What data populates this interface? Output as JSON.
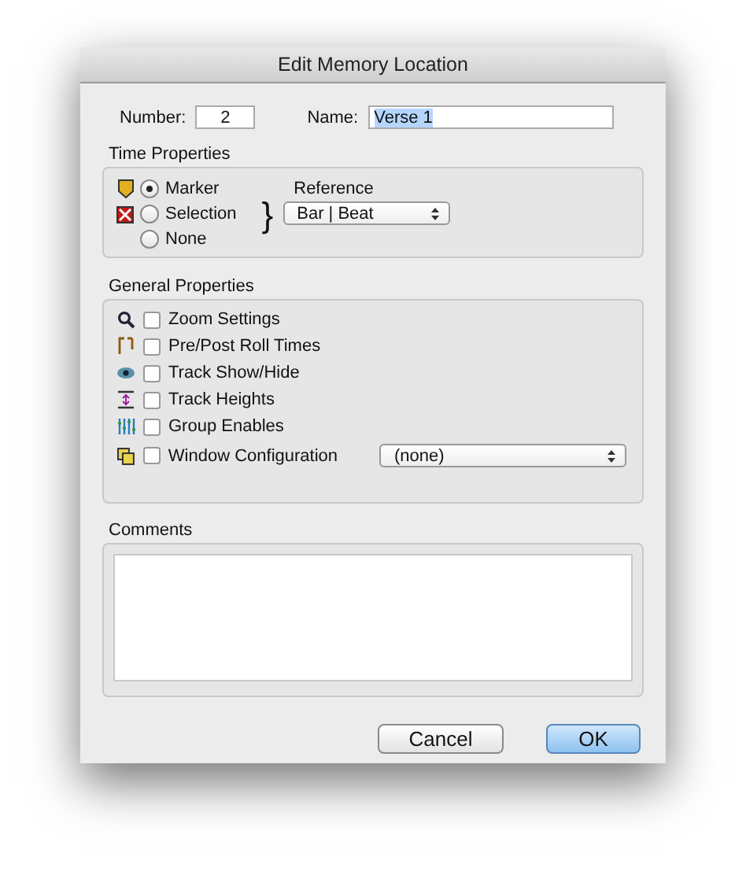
{
  "window": {
    "title": "Edit Memory Location"
  },
  "number": {
    "label": "Number:",
    "value": "2"
  },
  "name": {
    "label": "Name:",
    "value": "Verse 1",
    "text_selected": true
  },
  "time_properties": {
    "title": "Time Properties",
    "options": [
      {
        "label": "Marker",
        "selected": true
      },
      {
        "label": "Selection",
        "selected": false
      },
      {
        "label": "None",
        "selected": false
      }
    ],
    "brace": "}",
    "reference": {
      "label": "Reference",
      "value": "Bar | Beat"
    }
  },
  "general_properties": {
    "title": "General Properties",
    "items": [
      {
        "label": "Zoom Settings",
        "checked": false
      },
      {
        "label": "Pre/Post Roll Times",
        "checked": false
      },
      {
        "label": "Track Show/Hide",
        "checked": false
      },
      {
        "label": "Track Heights",
        "checked": false
      },
      {
        "label": "Group Enables",
        "checked": false
      },
      {
        "label": "Window Configuration",
        "checked": false,
        "dropdown": "(none)"
      }
    ]
  },
  "comments": {
    "title": "Comments"
  },
  "buttons": [
    {
      "label": "Cancel",
      "default": false
    },
    {
      "label": "OK",
      "default": true
    }
  ]
}
